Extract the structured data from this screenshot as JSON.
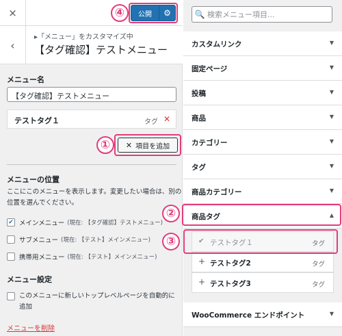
{
  "header": {
    "close_icon": "×",
    "publish_label": "公開",
    "gear_icon": "⚙",
    "back_icon": "‹",
    "breadcrumb": "▸「メニュー」をカスタマイズ中",
    "title": "【タグ確認】テストメニュー"
  },
  "callouts": [
    "①",
    "②",
    "③",
    "④"
  ],
  "menu": {
    "name_label": "メニュー名",
    "name_value": "【タグ確認】テストメニュー",
    "item": {
      "title": "テストタグ１",
      "type": "タグ",
      "delete_icon": "✕"
    },
    "add_items_icon": "✕",
    "add_items_label": "項目を追加"
  },
  "location": {
    "heading": "メニューの位置",
    "description": "ここにこのメニューを表示します。変更したい場合は、別の位置を選んでください。",
    "options": [
      {
        "label": "メインメニュー",
        "current": "(現在: 【タグ確認】テストメニュー)",
        "checked": true
      },
      {
        "label": "サブメニュー",
        "current": "(現在: 【テスト】メインメニュー)",
        "checked": false
      },
      {
        "label": "携帯用メニュー",
        "current": "(現在: 【テスト】メインメニュー)",
        "checked": false
      }
    ],
    "check_icon": "✔"
  },
  "settings": {
    "heading": "メニュー設定",
    "auto_add": "このメニューに新しいトップレベルページを自動的に追加"
  },
  "delete_menu": "メニューを削除",
  "search": {
    "placeholder": "検索メニュー項目...",
    "icon": "🔍"
  },
  "sections": [
    {
      "label": "カスタムリンク",
      "arrow": "▼"
    },
    {
      "label": "固定ページ",
      "arrow": "▼"
    },
    {
      "label": "投稿",
      "arrow": "▼"
    },
    {
      "label": "商品",
      "arrow": "▼"
    },
    {
      "label": "カテゴリー",
      "arrow": "▼"
    },
    {
      "label": "タグ",
      "arrow": "▼"
    },
    {
      "label": "商品カテゴリー",
      "arrow": "▼"
    },
    {
      "label": "商品タグ",
      "arrow": "▲"
    }
  ],
  "tag_items": [
    {
      "label": "テストタグ１",
      "type": "タグ",
      "icon": "✔",
      "added": true
    },
    {
      "label": "テストタグ2",
      "type": "タグ",
      "icon": "+",
      "added": false
    },
    {
      "label": "テストタグ3",
      "type": "タグ",
      "icon": "+",
      "added": false
    }
  ],
  "woocommerce": {
    "label": "WooCommerce エンドポイント",
    "arrow": "▼"
  }
}
